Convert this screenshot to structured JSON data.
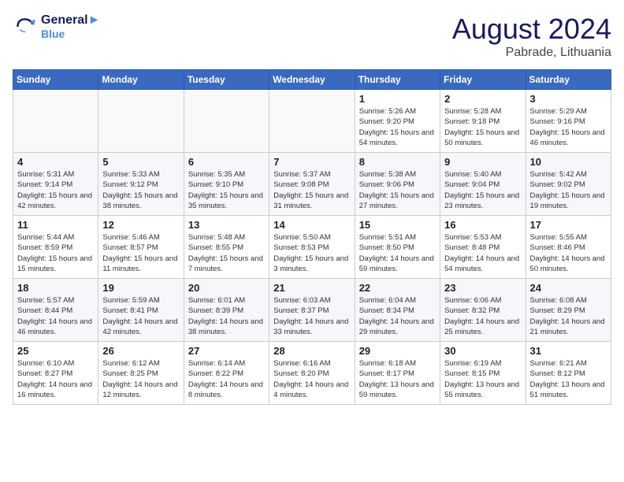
{
  "header": {
    "logo_line1": "General",
    "logo_line2": "Blue",
    "title": "August 2024",
    "subtitle": "Pabrade, Lithuania"
  },
  "days_of_week": [
    "Sunday",
    "Monday",
    "Tuesday",
    "Wednesday",
    "Thursday",
    "Friday",
    "Saturday"
  ],
  "weeks": [
    [
      {
        "day": "",
        "content": ""
      },
      {
        "day": "",
        "content": ""
      },
      {
        "day": "",
        "content": ""
      },
      {
        "day": "",
        "content": ""
      },
      {
        "day": "1",
        "content": "Sunrise: 5:26 AM\nSunset: 9:20 PM\nDaylight: 15 hours\nand 54 minutes."
      },
      {
        "day": "2",
        "content": "Sunrise: 5:28 AM\nSunset: 9:18 PM\nDaylight: 15 hours\nand 50 minutes."
      },
      {
        "day": "3",
        "content": "Sunrise: 5:29 AM\nSunset: 9:16 PM\nDaylight: 15 hours\nand 46 minutes."
      }
    ],
    [
      {
        "day": "4",
        "content": "Sunrise: 5:31 AM\nSunset: 9:14 PM\nDaylight: 15 hours\nand 42 minutes."
      },
      {
        "day": "5",
        "content": "Sunrise: 5:33 AM\nSunset: 9:12 PM\nDaylight: 15 hours\nand 38 minutes."
      },
      {
        "day": "6",
        "content": "Sunrise: 5:35 AM\nSunset: 9:10 PM\nDaylight: 15 hours\nand 35 minutes."
      },
      {
        "day": "7",
        "content": "Sunrise: 5:37 AM\nSunset: 9:08 PM\nDaylight: 15 hours\nand 31 minutes."
      },
      {
        "day": "8",
        "content": "Sunrise: 5:38 AM\nSunset: 9:06 PM\nDaylight: 15 hours\nand 27 minutes."
      },
      {
        "day": "9",
        "content": "Sunrise: 5:40 AM\nSunset: 9:04 PM\nDaylight: 15 hours\nand 23 minutes."
      },
      {
        "day": "10",
        "content": "Sunrise: 5:42 AM\nSunset: 9:02 PM\nDaylight: 15 hours\nand 19 minutes."
      }
    ],
    [
      {
        "day": "11",
        "content": "Sunrise: 5:44 AM\nSunset: 8:59 PM\nDaylight: 15 hours\nand 15 minutes."
      },
      {
        "day": "12",
        "content": "Sunrise: 5:46 AM\nSunset: 8:57 PM\nDaylight: 15 hours\nand 11 minutes."
      },
      {
        "day": "13",
        "content": "Sunrise: 5:48 AM\nSunset: 8:55 PM\nDaylight: 15 hours\nand 7 minutes."
      },
      {
        "day": "14",
        "content": "Sunrise: 5:50 AM\nSunset: 8:53 PM\nDaylight: 15 hours\nand 3 minutes."
      },
      {
        "day": "15",
        "content": "Sunrise: 5:51 AM\nSunset: 8:50 PM\nDaylight: 14 hours\nand 59 minutes."
      },
      {
        "day": "16",
        "content": "Sunrise: 5:53 AM\nSunset: 8:48 PM\nDaylight: 14 hours\nand 54 minutes."
      },
      {
        "day": "17",
        "content": "Sunrise: 5:55 AM\nSunset: 8:46 PM\nDaylight: 14 hours\nand 50 minutes."
      }
    ],
    [
      {
        "day": "18",
        "content": "Sunrise: 5:57 AM\nSunset: 8:44 PM\nDaylight: 14 hours\nand 46 minutes."
      },
      {
        "day": "19",
        "content": "Sunrise: 5:59 AM\nSunset: 8:41 PM\nDaylight: 14 hours\nand 42 minutes."
      },
      {
        "day": "20",
        "content": "Sunrise: 6:01 AM\nSunset: 8:39 PM\nDaylight: 14 hours\nand 38 minutes."
      },
      {
        "day": "21",
        "content": "Sunrise: 6:03 AM\nSunset: 8:37 PM\nDaylight: 14 hours\nand 33 minutes."
      },
      {
        "day": "22",
        "content": "Sunrise: 6:04 AM\nSunset: 8:34 PM\nDaylight: 14 hours\nand 29 minutes."
      },
      {
        "day": "23",
        "content": "Sunrise: 6:06 AM\nSunset: 8:32 PM\nDaylight: 14 hours\nand 25 minutes."
      },
      {
        "day": "24",
        "content": "Sunrise: 6:08 AM\nSunset: 8:29 PM\nDaylight: 14 hours\nand 21 minutes."
      }
    ],
    [
      {
        "day": "25",
        "content": "Sunrise: 6:10 AM\nSunset: 8:27 PM\nDaylight: 14 hours\nand 16 minutes."
      },
      {
        "day": "26",
        "content": "Sunrise: 6:12 AM\nSunset: 8:25 PM\nDaylight: 14 hours\nand 12 minutes."
      },
      {
        "day": "27",
        "content": "Sunrise: 6:14 AM\nSunset: 8:22 PM\nDaylight: 14 hours\nand 8 minutes."
      },
      {
        "day": "28",
        "content": "Sunrise: 6:16 AM\nSunset: 8:20 PM\nDaylight: 14 hours\nand 4 minutes."
      },
      {
        "day": "29",
        "content": "Sunrise: 6:18 AM\nSunset: 8:17 PM\nDaylight: 13 hours\nand 59 minutes."
      },
      {
        "day": "30",
        "content": "Sunrise: 6:19 AM\nSunset: 8:15 PM\nDaylight: 13 hours\nand 55 minutes."
      },
      {
        "day": "31",
        "content": "Sunrise: 6:21 AM\nSunset: 8:12 PM\nDaylight: 13 hours\nand 51 minutes."
      }
    ]
  ]
}
